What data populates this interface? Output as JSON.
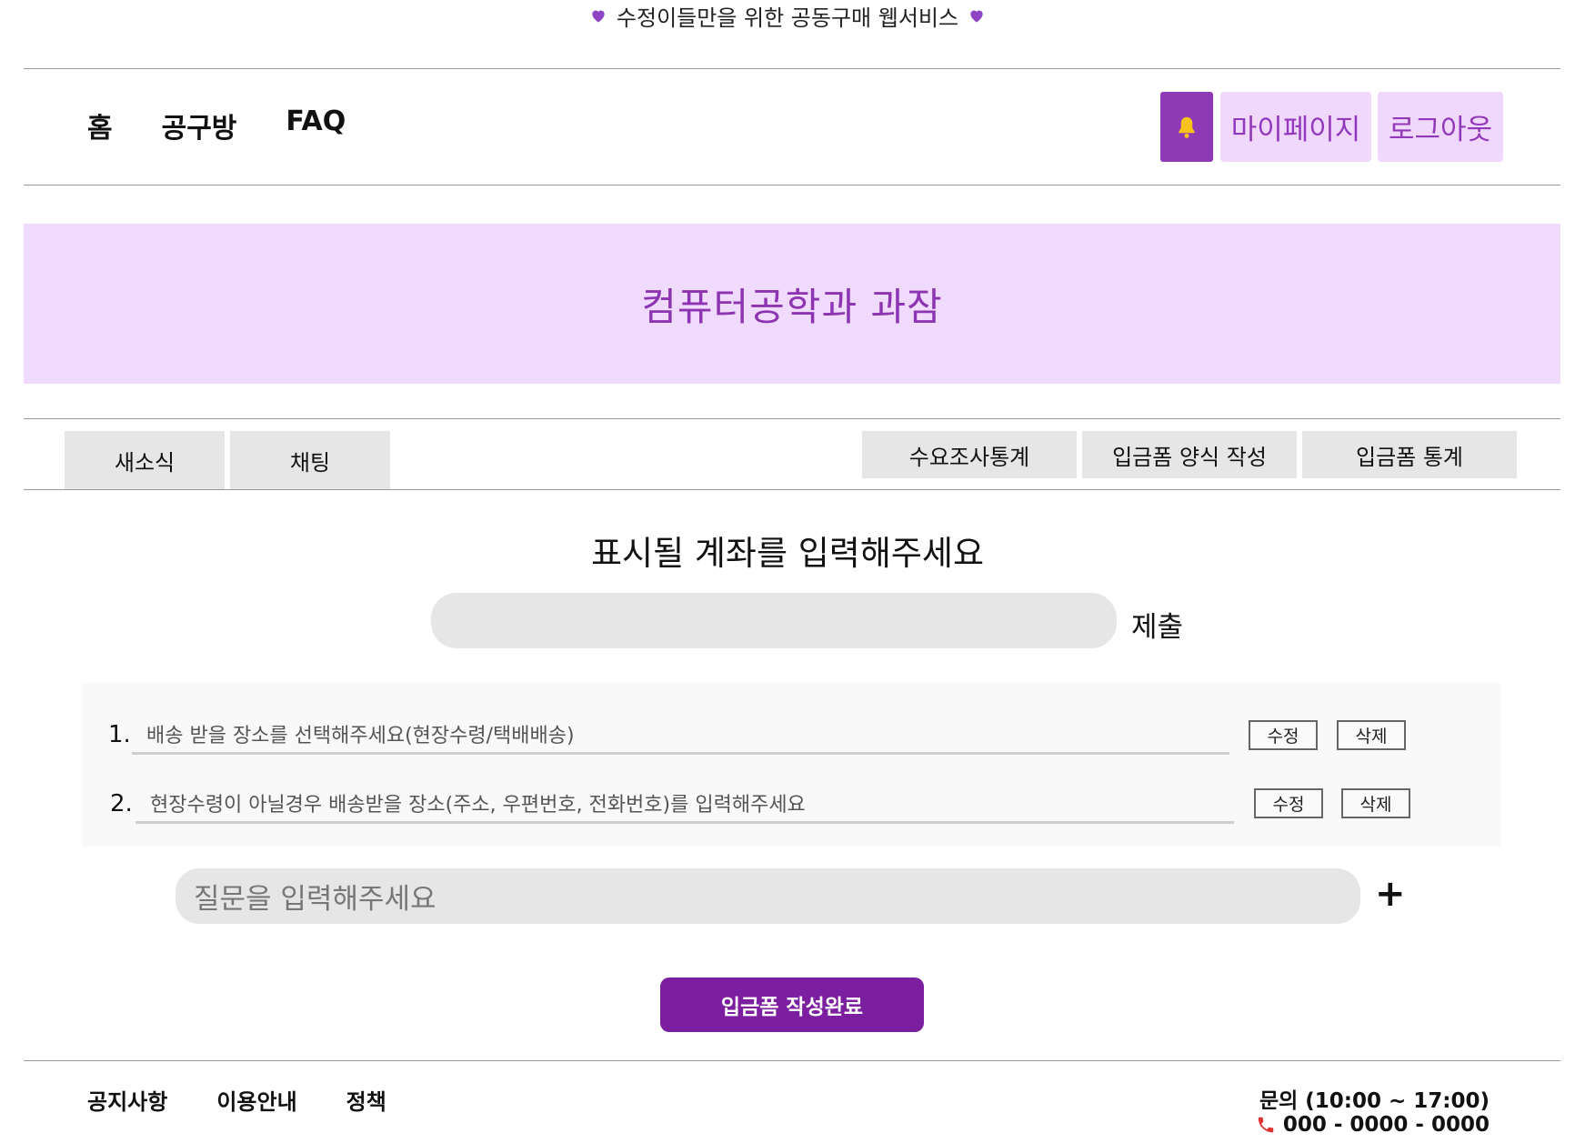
{
  "banner": {
    "text": "수정이들만을 위한 공동구매 웹서비스"
  },
  "nav": {
    "home": "홈",
    "room": "공구방",
    "faq": "FAQ"
  },
  "header_buttons": {
    "mypage": "마이페이지",
    "logout": "로그아웃"
  },
  "hero": {
    "title": "컴퓨터공학과 과잠"
  },
  "tabs": {
    "left": [
      "새소식",
      "채팅"
    ],
    "right": [
      "수요조사통계",
      "입금폼 양식 작성",
      "입금폼 통계"
    ]
  },
  "account": {
    "title": "표시될 계좌를 입력해주세요",
    "value": "",
    "submit": "제출"
  },
  "questions": [
    {
      "num": "1.",
      "text": "배송 받을 장소를 선택해주세요(현장수령/택배배송)",
      "edit": "수정",
      "delete": "삭제"
    },
    {
      "num": "2.",
      "text": "현장수령이 아닐경우 배송받을 장소(주소, 우편번호, 전화번호)를 입력해주세요",
      "edit": "수정",
      "delete": "삭제"
    }
  ],
  "new_question": {
    "placeholder": "질문을 입력해주세요",
    "add": "+"
  },
  "complete_button": "입금폼 작성완료",
  "footer": {
    "links": [
      "공지사항",
      "이용안내",
      "정책"
    ],
    "contact_title": "문의 (10:00 ~ 17:00)",
    "contact_phone": "000 - 0000 - 0000"
  },
  "colors": {
    "accent": "#8e3ab6",
    "accent_light": "#f0dafd",
    "button": "#7c1ea0"
  },
  "icons": [
    "purple-heart-icon",
    "bell-icon",
    "phone-icon"
  ]
}
